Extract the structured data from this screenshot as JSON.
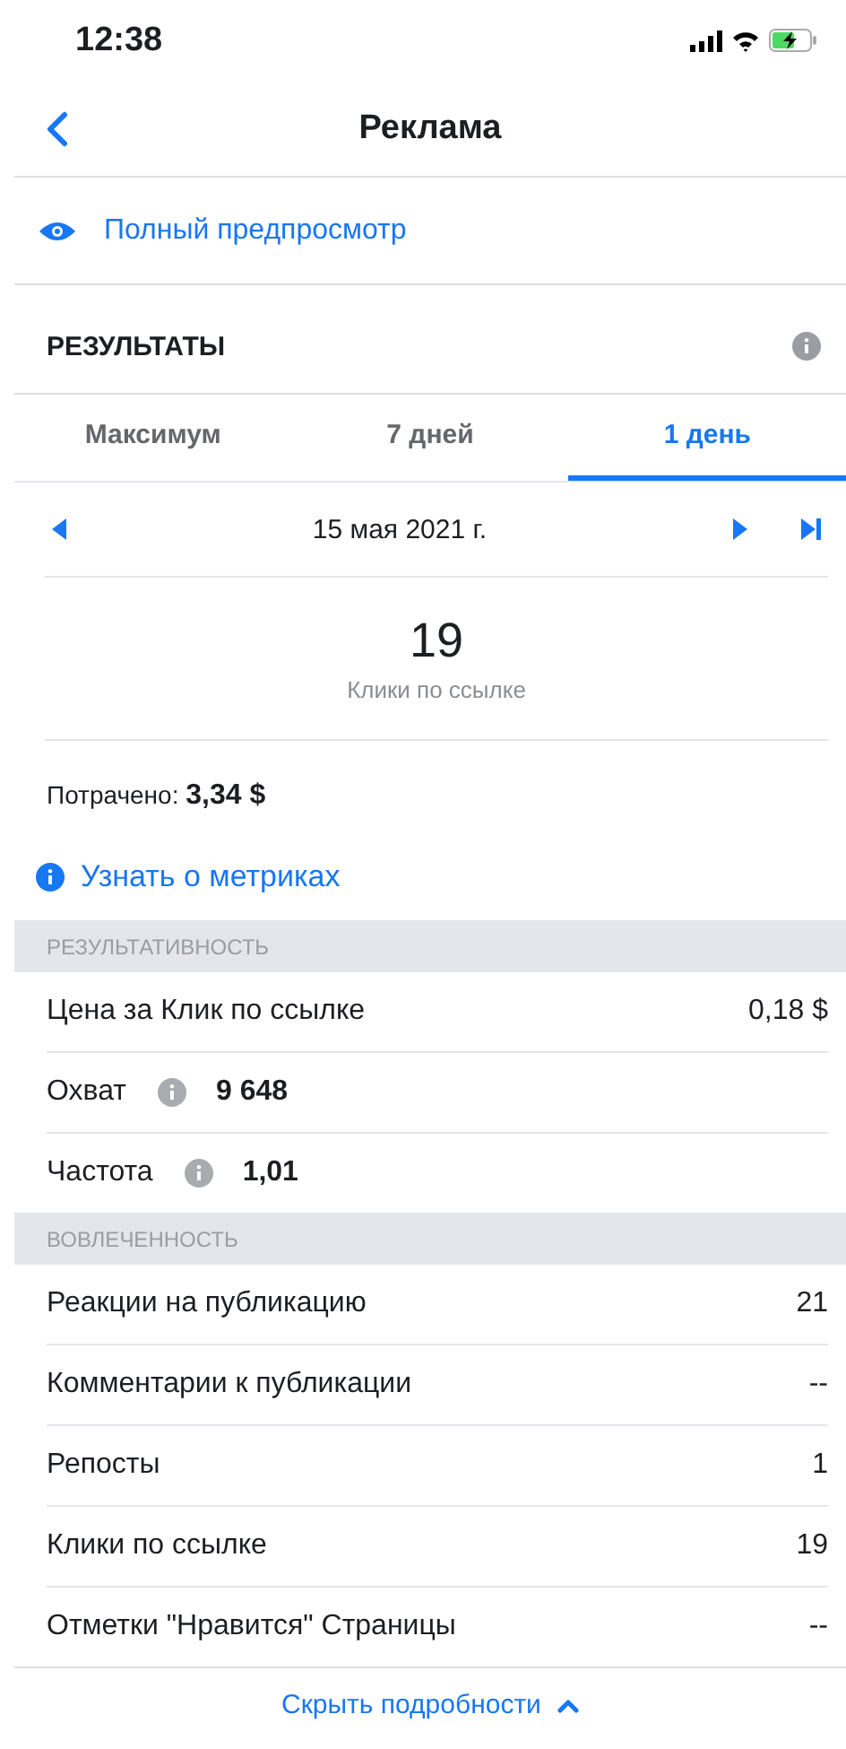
{
  "status_bar": {
    "time": "12:38"
  },
  "nav": {
    "title": "Реклама"
  },
  "preview_link": "Полный предпросмотр",
  "results": {
    "title": "РЕЗУЛЬТАТЫ"
  },
  "tabs": [
    {
      "label": "Максимум",
      "selected": false
    },
    {
      "label": "7 дней",
      "selected": false
    },
    {
      "label": "1 день",
      "selected": true
    }
  ],
  "date": "15 мая 2021 г.",
  "summary": {
    "value": "19",
    "label": "Клики по ссылке"
  },
  "spent": {
    "label": "Потрачено:",
    "value": "3,34 $"
  },
  "metrics_link": "Узнать о метриках",
  "sections": [
    {
      "title": "РЕЗУЛЬТАТИВНОСТЬ",
      "rows": [
        {
          "kind": "plain",
          "label": "Цена за Клик по ссылке",
          "value": "0,18 $"
        },
        {
          "kind": "info",
          "label": "Охват",
          "value": "9 648"
        },
        {
          "kind": "info",
          "label": "Частота",
          "value": "1,01"
        }
      ]
    },
    {
      "title": "ВОВЛЕЧЕННОСТЬ",
      "rows": [
        {
          "kind": "plain",
          "label": "Реакции на публикацию",
          "value": "21"
        },
        {
          "kind": "plain",
          "label": "Комментарии к публикации",
          "value": "--"
        },
        {
          "kind": "plain",
          "label": "Репосты",
          "value": "1"
        },
        {
          "kind": "plain",
          "label": "Клики по ссылке",
          "value": "19"
        },
        {
          "kind": "plain",
          "label": "Отметки \"Нравится\" Страницы",
          "value": "--"
        }
      ]
    }
  ],
  "hide_link": "Скрыть подробности"
}
